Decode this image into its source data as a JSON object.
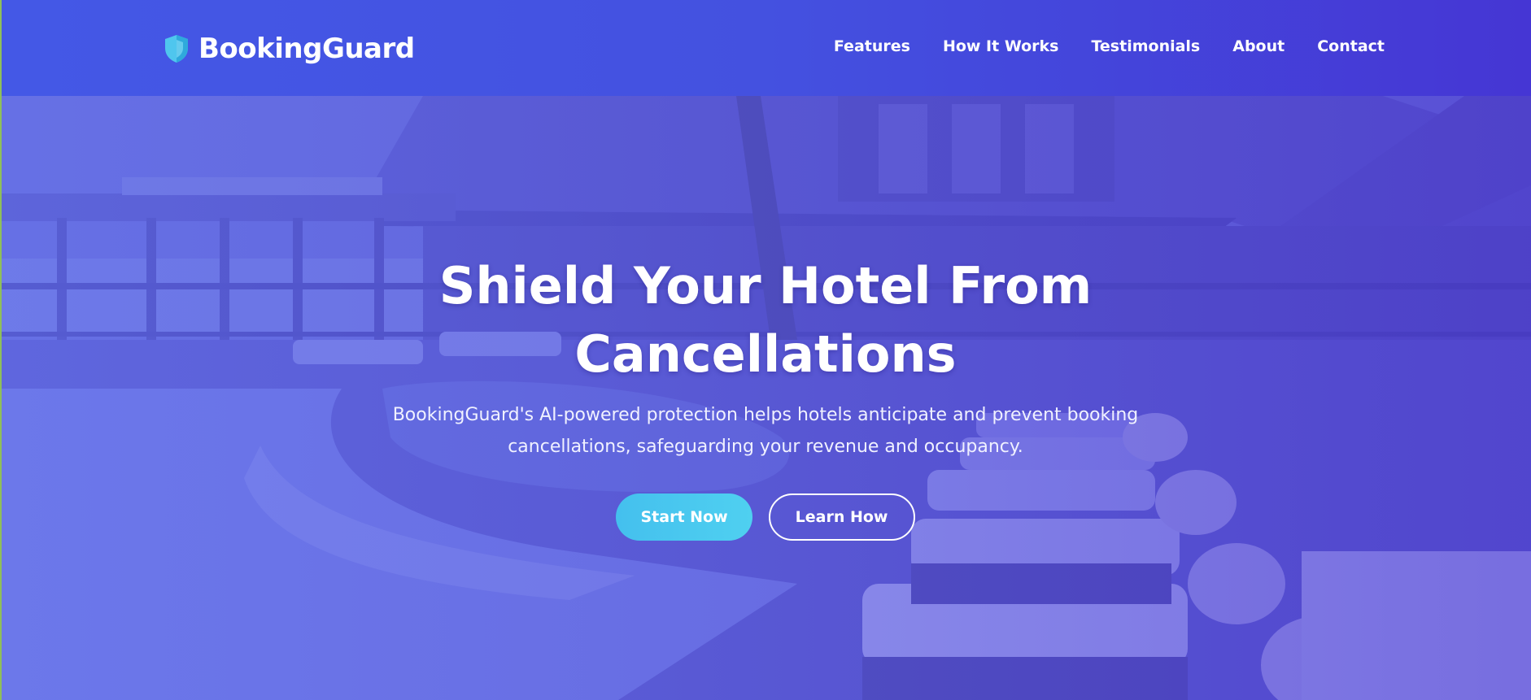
{
  "brand": {
    "name": "BookingGuard",
    "icon": "shield-icon"
  },
  "nav": {
    "items": [
      {
        "label": "Features"
      },
      {
        "label": "How It Works"
      },
      {
        "label": "Testimonials"
      },
      {
        "label": "About"
      },
      {
        "label": "Contact"
      }
    ]
  },
  "hero": {
    "title": "Shield Your Hotel From Cancellations",
    "subtitle": "BookingGuard's AI-powered protection helps hotels anticipate and prevent booking cancellations, safeguarding your revenue and occupancy.",
    "primary_button": "Start Now",
    "secondary_button": "Learn How"
  },
  "colors": {
    "header_start": "#4458e6",
    "header_end": "#4536d4",
    "accent": "#4fc6ee",
    "text": "#ffffff"
  }
}
